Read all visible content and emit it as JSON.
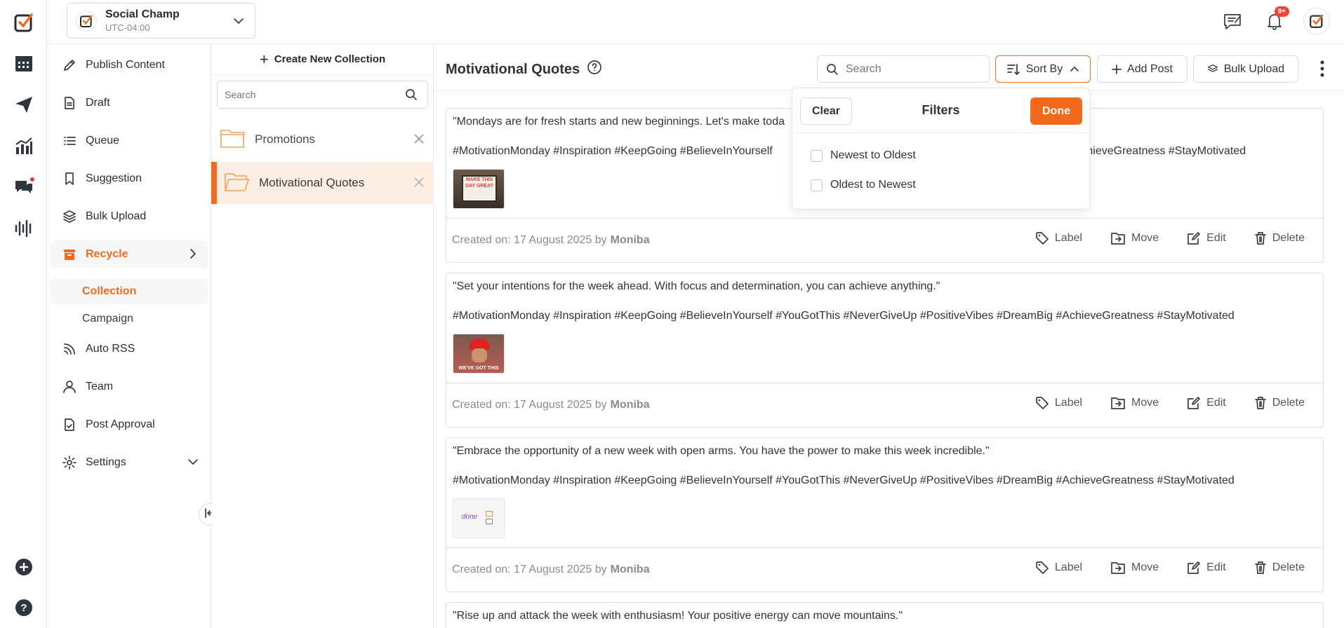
{
  "app": {
    "workspace_name": "Social Champ",
    "workspace_timezone": "UTC-04:00",
    "notifications_badge": "9+",
    "accent_color": "#f26b1d"
  },
  "rail": {
    "icons": [
      "logo-icon",
      "calendar-icon",
      "send-icon",
      "analytics-icon",
      "engagement-icon",
      "listening-icon",
      "add-icon",
      "help-icon"
    ]
  },
  "sidebar": {
    "items": [
      {
        "label": "Publish Content",
        "icon": "pen-icon"
      },
      {
        "label": "Draft",
        "icon": "file-icon"
      },
      {
        "label": "Queue",
        "icon": "list-icon"
      },
      {
        "label": "Suggestion",
        "icon": "bookmark-icon"
      },
      {
        "label": "Bulk Upload",
        "icon": "layers-icon"
      },
      {
        "label": "Recycle",
        "icon": "recycle-icon"
      },
      {
        "label": "Auto RSS",
        "icon": "rss-icon"
      },
      {
        "label": "Team",
        "icon": "user-icon"
      },
      {
        "label": "Post Approval",
        "icon": "approval-icon"
      },
      {
        "label": "Settings",
        "icon": "gear-icon"
      }
    ],
    "sub_items": [
      "Collection",
      "Campaign"
    ]
  },
  "collections": {
    "create_label": "Create New Collection",
    "search_placeholder": "Search",
    "items": [
      {
        "name": "Promotions"
      },
      {
        "name": "Motivational Quotes"
      }
    ]
  },
  "main": {
    "title": "Motivational Quotes",
    "search_placeholder": "Search",
    "sort_label": "Sort By",
    "add_post_label": "Add Post",
    "bulk_upload_label": "Bulk Upload"
  },
  "filters": {
    "clear_label": "Clear",
    "title": "Filters",
    "done_label": "Done",
    "options": [
      "Newest to Oldest",
      "Oldest to Newest"
    ]
  },
  "posts": [
    {
      "quote": "\"Mondays are for fresh starts and new beginnings. Let's make toda",
      "tags_left": "#MotivationMonday #Inspiration #KeepGoing #BelieveInYourself",
      "tags_right": "AchieveGreatness #StayMotivated",
      "created_prefix": "Created on: 17 August 2025 by",
      "author": "Moniba",
      "thumb_text": "MAKE THIS DAY GREAT"
    },
    {
      "quote": "\"Set your intentions for the week ahead. With focus and determination, you can achieve anything.\"",
      "tags": "#MotivationMonday #Inspiration #KeepGoing #BelieveInYourself #YouGotThis #NeverGiveUp #PositiveVibes #DreamBig #AchieveGreatness #StayMotivated",
      "created_prefix": "Created on: 17 August 2025 by",
      "author": "Moniba",
      "thumb_text": "WE'VE GOT THIS"
    },
    {
      "quote": "\"Embrace the opportunity of a new week with open arms. You have the power to make this week incredible.\"",
      "tags": "#MotivationMonday #Inspiration #KeepGoing #BelieveInYourself #YouGotThis #NeverGiveUp #PositiveVibes #DreamBig #AchieveGreatness #StayMotivated",
      "created_prefix": "Created on: 17 August 2025 by",
      "author": "Moniba",
      "thumb_text": "done"
    },
    {
      "quote": "\"Rise up and attack the week with enthusiasm! Your positive energy can move mountains.\""
    }
  ],
  "post_actions": {
    "label": "Label",
    "move": "Move",
    "edit": "Edit",
    "delete": "Delete"
  }
}
